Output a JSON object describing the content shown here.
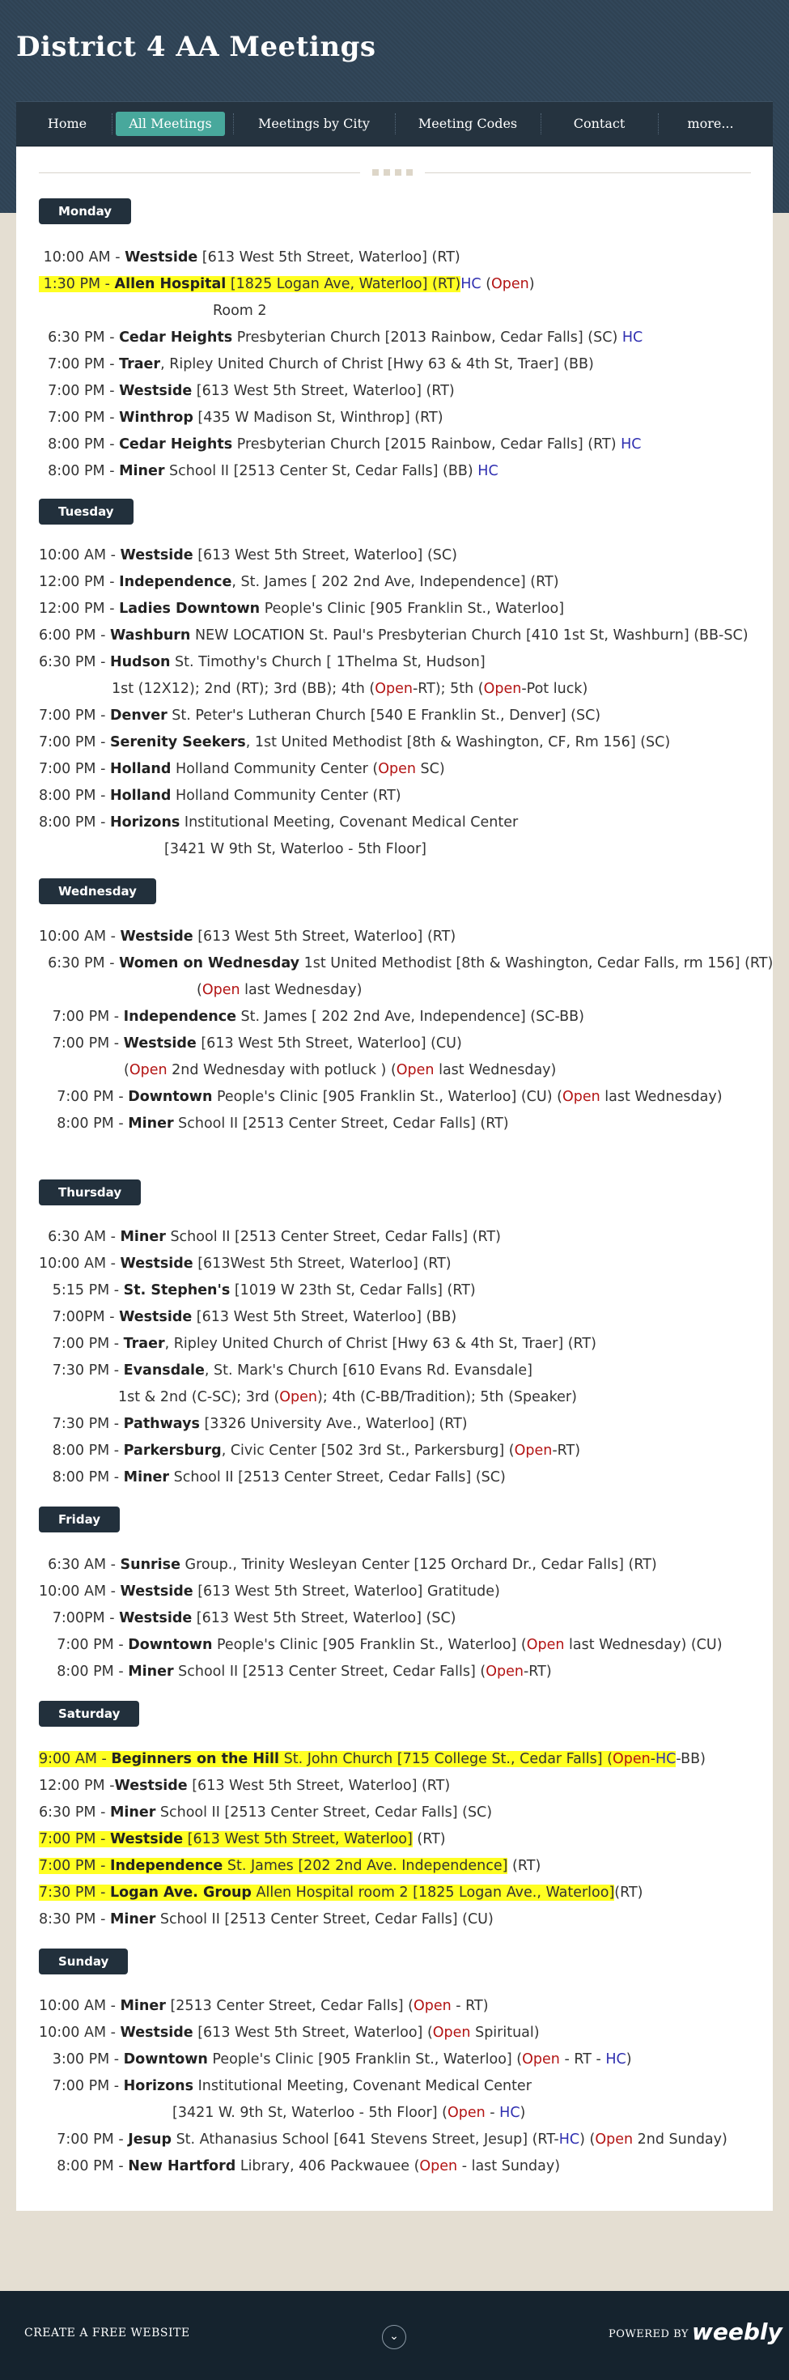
{
  "site": {
    "title": "District 4 AA Meetings"
  },
  "nav": [
    "Home",
    "All Meetings",
    "Meetings by City",
    "Meeting Codes",
    "Contact",
    "more..."
  ],
  "days": [
    "Monday",
    "Tuesday",
    "Wednesday",
    "Thursday",
    "Friday",
    "Saturday",
    "Sunday"
  ],
  "footer": {
    "left": "CREATE A FREE WEBSITE",
    "powered": "POWERED BY",
    "logo": "weebly"
  },
  "colors": {
    "header": "#2f4253",
    "nav": "#25333f",
    "active_nav": "#48a89c",
    "highlight": "#ffff22",
    "open": "#b31414",
    "hc": "#2f2fb0"
  },
  "icons": {
    "chevron": "chevron-down-icon"
  },
  "m": {
    "mon1": [
      "10:00 AM - ",
      "Westside",
      " [613 West 5th Street, Waterloo] (RT)"
    ],
    "mon2": [
      "1:30 PM - ",
      " Allen Hospital",
      "  [1825 Logan Ave, Waterloo] (RT)",
      "HC",
      " (",
      "Open",
      ")"
    ],
    "mon2b": "Room 2",
    "mon3": [
      "6:30 PM - ",
      "Cedar Heights",
      " Presbyterian Church [2013 Rainbow, Cedar Falls] (SC) ",
      "HC"
    ],
    "mon4": [
      "7:00 PM - ",
      "Traer",
      ", Ripley United Church of Christ [Hwy 63 & 4th St, Traer] (BB)"
    ],
    "mon5": [
      "7:00 PM - ",
      "Westside",
      " [613 West 5th Street, Waterloo] (RT)"
    ],
    "mon6": [
      "7:00 PM - ",
      "Winthrop",
      " [435 W Madison St, Winthrop] (RT)"
    ],
    "mon7": [
      "8:00 PM - ",
      "Cedar Heights",
      " Presbyterian Church [2015 Rainbow, Cedar Falls] (RT) ",
      "HC"
    ],
    "mon8": [
      "8:00 PM - ",
      "Miner",
      " School II [2513 Center St, Cedar Falls] (BB) ",
      "HC"
    ],
    "tue1": [
      "10:00 AM - ",
      "Westside",
      " [613 West 5th Street, Waterloo] (SC)"
    ],
    "tue2": [
      "12:00 PM - ",
      "Independence",
      ", St. James [ 202 2nd Ave, Independence] (RT)"
    ],
    "tue3": [
      "12:00 PM - ",
      "Ladies Downtown",
      " People's Clinic [905 Franklin St., Waterloo]"
    ],
    "tue4": [
      "6:00 PM - ",
      "Washburn",
      "  NEW LOCATION St. Paul's Presbyterian Church [410 1st St, Washburn] (BB-SC)"
    ],
    "tue5": [
      "6:30 PM - ",
      "Hudson",
      "  St. Timothy's Church [ 1Thelma St, Hudson]"
    ],
    "tue5b": [
      "1st (12X12); 2nd (RT); 3rd (BB); 4th (",
      "Open",
      "-RT); 5th (",
      "Open",
      "-Pot luck)"
    ],
    "tue6": [
      "7:00 PM - ",
      "Denver",
      " St. Peter's Lutheran Church [540 E Franklin St., Denver] (SC)"
    ],
    "tue7": [
      "7:00 PM - ",
      "Serenity Seekers",
      ", 1st United Methodist [8th & Washington, CF, Rm 156] (SC)"
    ],
    "tue8": [
      "7:00 PM - ",
      "Holland",
      " Holland Community Center (",
      "Open",
      " SC)"
    ],
    "tue9": [
      "8:00 PM - ",
      "Holland",
      " Holland Community Center (RT)"
    ],
    "tue10": [
      "8:00 PM - ",
      "Horizons",
      " Institutional Meeting, Covenant Medical Center"
    ],
    "tue10b": "[3421 W 9th St, Waterloo - 5th Floor]",
    "wed1": [
      "10:00 AM - ",
      "Westside",
      "  [613 West 5th Street, Waterloo] (RT)"
    ],
    "wed2": [
      "6:30 PM - ",
      "Women on Wednesday",
      " 1st United Methodist [8th & Washington, Cedar Falls, rm 156] (RT)"
    ],
    "wed2b": [
      "(",
      "Open",
      " last Wednesday)"
    ],
    "wed3": [
      "7:00 PM - ",
      "Independence",
      "  St. James [ 202 2nd Ave, Independence] (SC-BB)"
    ],
    "wed4": [
      "7:00 PM  - ",
      "Westside",
      " [613 West 5th Street, Waterloo] (CU)"
    ],
    "wed4b": [
      "(",
      "Open",
      " 2nd Wednesday with potluck ) (",
      "Open",
      " last Wednesday)"
    ],
    "wed5": [
      "7:00 PM - ",
      "Downtown",
      " People's Clinic [905 Franklin St., Waterloo]  (CU)  (",
      "Open",
      " last Wednesday)"
    ],
    "wed6": [
      "8:00 PM - ",
      "Miner",
      " School II [2513 Center Street, Cedar Falls] (RT)"
    ],
    "thu1": [
      "6:30 AM - ",
      "Miner",
      " School II [2513 Center Street, Cedar Falls] (RT)"
    ],
    "thu2": [
      "10:00 AM - ",
      "Westside",
      "  [613West 5th Street, Waterloo]  (RT)"
    ],
    "thu3": [
      "5:15 PM - ",
      " St.  Stephen's",
      " [1019 W 23th St, Cedar Falls] (RT)"
    ],
    "thu4": [
      "7:00PM - ",
      "Westside",
      " [613 West 5th Street, Waterloo] (BB)"
    ],
    "thu5": [
      "7:00 PM - ",
      "Traer",
      ", Ripley United Church of Christ [Hwy 63 & 4th St, Traer] (RT)"
    ],
    "thu6": [
      "7:30 PM - ",
      "Evansdale",
      ", St. Mark's Church [610 Evans Rd. Evansdale]"
    ],
    "thu6b": [
      "1st & 2nd (C-SC); 3rd (",
      "Open",
      "); 4th (C-BB/Tradition); 5th (Speaker)"
    ],
    "thu7": [
      "7:30 PM - ",
      "Pathways",
      "  [3326 University Ave., Waterloo] (RT)"
    ],
    "thu8": [
      "8:00 PM - ",
      "Parkersburg",
      ", Civic Center [502 3rd St., Parkersburg] (",
      "Open",
      "-RT)"
    ],
    "thu9": [
      "8:00 PM - ",
      "Miner",
      " School II [2513 Center Street, Cedar Falls] (SC)"
    ],
    "fri1": [
      "6:30 AM - ",
      "Sunrise",
      " Group., Trinity Wesleyan Center [125 Orchard Dr., Cedar Falls] (RT)"
    ],
    "fri2": [
      "10:00 AM - ",
      "Westside",
      " [613 West 5th Street, Waterloo] Gratitude)"
    ],
    "fri3": [
      "7:00PM - ",
      "Westside",
      " [613 West 5th Street, Waterloo] (SC)"
    ],
    "fri4": [
      "7:00 PM - ",
      "Downtown",
      " People's Clinic [905 Franklin St., Waterloo] (",
      "Open",
      " last Wednesday) (CU)"
    ],
    "fri5": [
      "8:00 PM - ",
      "Miner",
      " School II [2513 Center Street, Cedar Falls] (",
      "Open",
      "-RT)"
    ],
    "sat1": [
      "9:00 AM - ",
      "Beginners on the Hill",
      " St. John Church [715 College St., Cedar Falls] (",
      "Open",
      "-",
      "HC",
      "-BB)"
    ],
    "sat2": [
      "12:00 PM -",
      "Westside",
      " [613 West 5th Street, Waterloo] (RT)"
    ],
    "sat3": [
      "6:30 PM - ",
      "Miner",
      " School II [2513 Center Street, Cedar Falls] (SC)"
    ],
    "sat4": [
      "7:00 PM - ",
      "Westside",
      " [613 West 5th Street, Waterloo]",
      " (RT)"
    ],
    "sat5": [
      "7:00 PM - ",
      "Independence",
      " St. James  [202 2nd Ave. Independence]",
      " (RT)"
    ],
    "sat6": [
      "7:30 PM - ",
      "Logan Ave. Group",
      " Allen Hospital room 2 [1825 Logan Ave., Waterloo]",
      "(RT)"
    ],
    "sat7": [
      "8:30 PM - ",
      "Miner",
      " School II [2513 Center Street, Cedar Falls] (CU)"
    ],
    "sun1": [
      "10:00 AM - ",
      "Miner",
      " [2513 Center Street, Cedar Falls] (",
      "Open",
      " - RT)"
    ],
    "sun2": [
      "10:00 AM - ",
      "Westside",
      " [613 West 5th Street, Waterloo] (",
      "Open",
      " Spiritual)"
    ],
    "sun3": [
      "3:00 PM - ",
      "Downtown",
      " People's Clinic [905 Franklin St., Waterloo] (",
      "Open",
      " - RT - ",
      "HC",
      ")"
    ],
    "sun4": [
      "7:00 PM - ",
      "Horizons",
      " Institutional Meeting, Covenant Medical Center"
    ],
    "sun4b": [
      "[3421 W. 9th St, Waterloo - 5th Floor]  (",
      "Open",
      " - ",
      "HC",
      ")"
    ],
    "sun5": [
      "7:00 PM - ",
      "Jesup",
      " St. Athanasius School [641 Stevens Street, Jesup] (RT-",
      "HC",
      ") (",
      "Open",
      " 2nd Sunday)"
    ],
    "sun6": [
      "8:00 PM - ",
      "New Hartford",
      " Library, 406 Packwauee (",
      "Open",
      " - last Sunday)"
    ]
  }
}
